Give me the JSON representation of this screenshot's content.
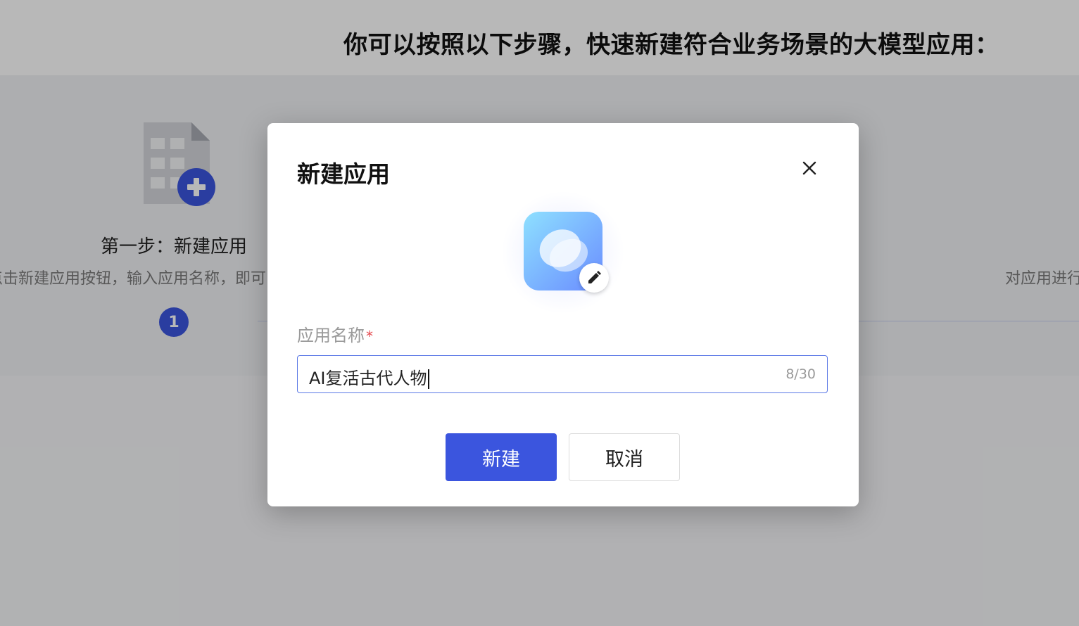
{
  "background": {
    "headline": "你可以按照以下步骤，快速新建符合业务场景的大模型应用：",
    "step1": {
      "icon": "file-add-icon",
      "number": "1",
      "title": "第一步：新建应用",
      "description": "点击新建应用按钮，输入应用名称，即可"
    },
    "step2_description_partial": "对应用进行"
  },
  "modal": {
    "title": "新建应用",
    "close_icon": "close-icon",
    "app_icon": "app-avatar-icon",
    "edit_icon": "pencil-icon",
    "field_label": "应用名称",
    "required_mark": "*",
    "input_value": "AI复活古代人物",
    "char_count": "8/30",
    "create_label": "新建",
    "cancel_label": "取消"
  },
  "colors": {
    "primary": "#3b55de",
    "required": "#e5484d",
    "overlay": "rgba(0,0,0,0.28)"
  }
}
